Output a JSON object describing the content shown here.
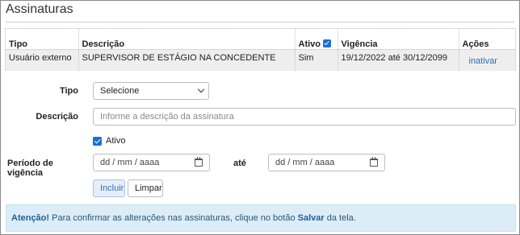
{
  "panel": {
    "title": "Assinaturas"
  },
  "table": {
    "headers": {
      "tipo": "Tipo",
      "descricao": "Descrição",
      "ativo": "Ativo",
      "vigencia": "Vigência",
      "acoes": "Ações"
    },
    "rows": [
      {
        "tipo": "Usuário externo",
        "descricao": "SUPERVISOR DE ESTÁGIO NA CONCEDENTE",
        "ativo": "Sim",
        "vigencia": "19/12/2022 até 30/12/2099",
        "acao": "inativar"
      }
    ]
  },
  "form": {
    "tipo_label": "Tipo",
    "tipo_value": "Selecione",
    "descricao_label": "Descrição",
    "descricao_placeholder": "Informe a descrição da assinatura",
    "ativo_label": "Ativo",
    "ativo_checked": true,
    "periodo_label": "Período de vigência",
    "date_start_placeholder": "dd / mm / aaaa",
    "ate_label": "até",
    "date_end_placeholder": "dd / mm / aaaa",
    "incluir_label": "Incluir",
    "limpar_label": "Limpar"
  },
  "alert": {
    "strong": "Atenção!",
    "text_before": "Para confirmar as alterações nas assinaturas, clique no botão",
    "button_name": "Salvar",
    "text_after": "da tela."
  },
  "colors": {
    "accent": "#1a6fd1",
    "alert_bg": "#dcedf8",
    "link": "#2a6ebb"
  }
}
